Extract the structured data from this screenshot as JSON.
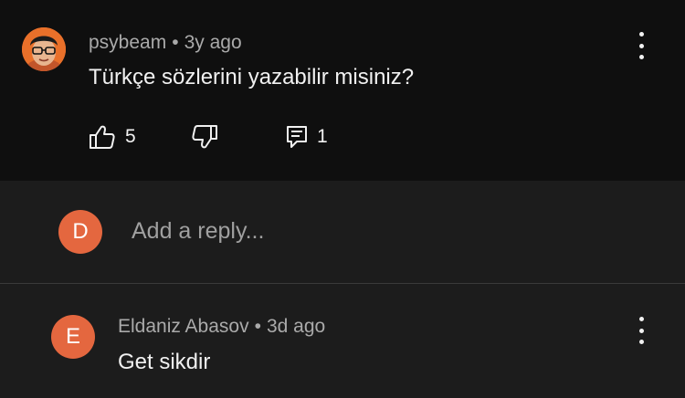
{
  "comment": {
    "author": "psybeam",
    "separator": "•",
    "time": "3y ago",
    "text": "Türkçe sözlerini yazabilir misiniz?",
    "like_count": "5",
    "reply_count": "1",
    "icons": [
      "thumbs-up-icon",
      "thumbs-down-icon",
      "reply-comment-icon",
      "more-vertical-icon"
    ]
  },
  "reply_box": {
    "avatar_letter": "D",
    "placeholder": "Add a reply..."
  },
  "reply": {
    "avatar_letter": "E",
    "author": "Eldaniz Abasov",
    "separator": "•",
    "time": "3d ago",
    "text": "Get sikdir"
  },
  "colors": {
    "background": "#0f0f0f",
    "panel": "#1c1c1c",
    "text_primary": "#f1f1f1",
    "text_secondary": "#aaaaaa",
    "avatar_orange": "#e4673f"
  }
}
